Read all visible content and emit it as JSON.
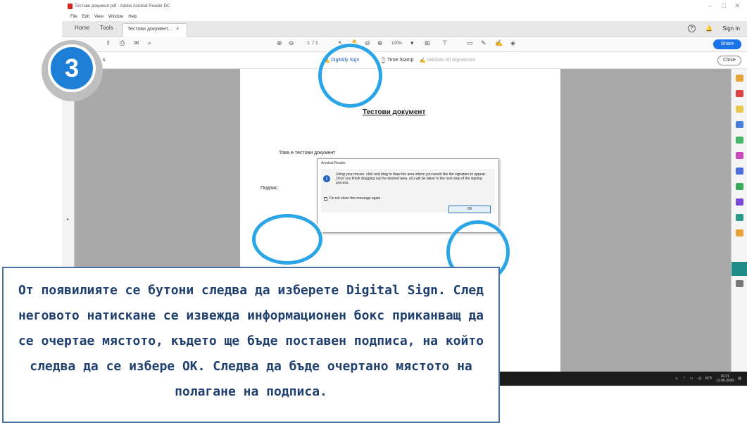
{
  "window": {
    "title": "Тестови документ.pdf - Adobe Acrobat Reader DC",
    "controls": [
      "–",
      "□",
      "✕"
    ]
  },
  "menu": [
    "File",
    "Edit",
    "View",
    "Window",
    "Help"
  ],
  "tabs": {
    "home": "Home",
    "tools": "Tools",
    "document": "Тестови документ...",
    "close": "×",
    "sign_in": "Sign In"
  },
  "toolbar": {
    "page_current": "1",
    "page_total": "/ 1",
    "zoom": "100%",
    "share": "Share"
  },
  "signbar": {
    "left_label": "s",
    "digitally_sign": "Digitally Sign",
    "time_stamp": "Time Stamp",
    "validate": "Validate All Signatures",
    "close": "Close"
  },
  "document": {
    "title": "Тестови документ",
    "body_text": "Това е тестови документ",
    "signature_label": "Подпис:"
  },
  "dialog": {
    "title": "Acrobat Reader",
    "message": "Using your mouse, click and drag to draw the area where you would like the signature to appear. Once you finish dragging out the desired area, you will be taken to the next step of the signing process.",
    "checkbox_label": "Do not show this message again",
    "ok": "OK"
  },
  "taskbar": {
    "lang": "БГР",
    "time": "16:21",
    "date": "12.06.2020"
  },
  "step": {
    "number": "3"
  },
  "caption": {
    "text": "От появилияте се бутони следва да изберете Digital Sign. След неговото натискане се извежда информационен бокс приканващ да се очертае мястото, където ще бъде поставен подписа, на който следва да се избере ОК. Следва да бъде очертано мястото на полагане на подписа."
  },
  "colors": {
    "highlight": "#2aa6e8",
    "step_badge": "#1e7fd6",
    "caption_text": "#1f3f6e",
    "share_button": "#1a73e8",
    "active_tool": "#1f8c86"
  }
}
